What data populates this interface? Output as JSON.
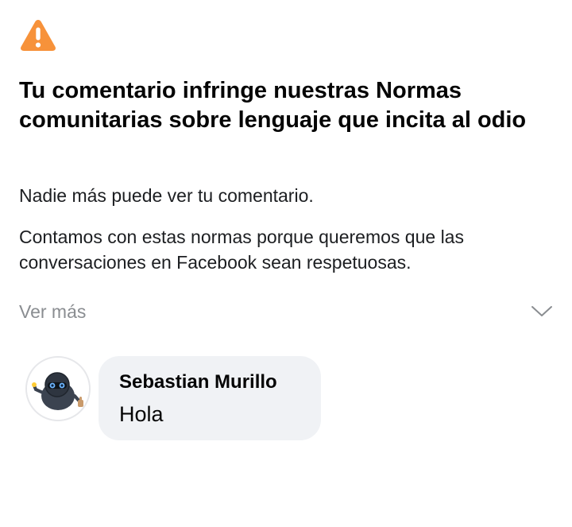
{
  "notice": {
    "icon": "warning-triangle-icon",
    "icon_color": "#F7923A",
    "title": "Tu comentario infringe nuestras Normas comunitarias sobre lenguaje que incita al odio",
    "subtitle": "Nadie más puede ver tu comentario.",
    "reason": "Contamos con estas normas porque queremos que las conversaciones en Facebook sean respetuosas.",
    "ver_mas_label": "Ver más",
    "ver_mas_icon": "chevron-down-icon"
  },
  "comment": {
    "author": "Sebastian Murillo",
    "text": "Hola",
    "avatar_icon": "avatar",
    "bubble_color": "#F0F2F5"
  }
}
